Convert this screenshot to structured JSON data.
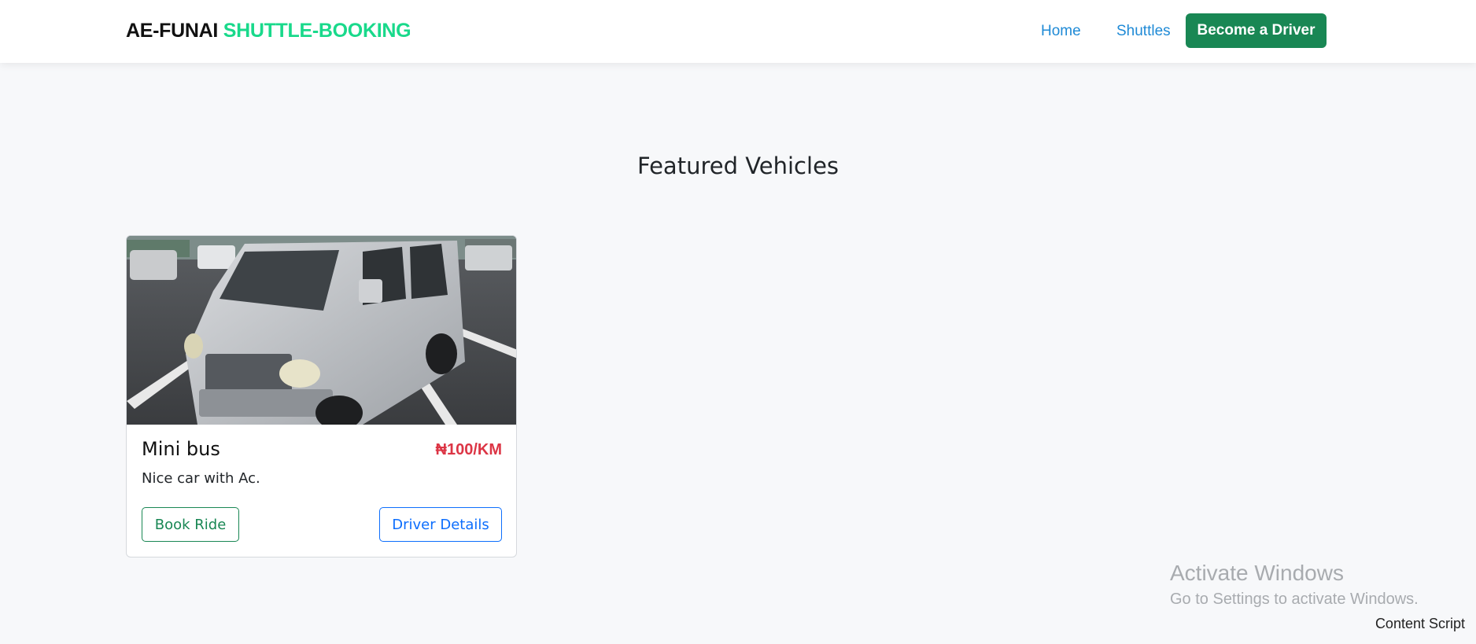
{
  "navbar": {
    "brand_part1": "AE-FUNAI",
    "brand_part2": "SHUTTLE-BOOKING",
    "links": [
      {
        "label": "Home"
      },
      {
        "label": "Shuttles"
      }
    ],
    "cta_label": "Become a Driver"
  },
  "main": {
    "section_title": "Featured Vehicles",
    "vehicles": [
      {
        "title": "Mini bus",
        "price": "₦100/KM",
        "description": "Nice car with Ac.",
        "book_label": "Book Ride",
        "details_label": "Driver Details"
      }
    ]
  },
  "overlay": {
    "activate_title": "Activate Windows",
    "activate_sub": "Go to Settings to activate Windows.",
    "content_script": "Content Script"
  },
  "colors": {
    "brand_accent": "#19d98b",
    "primary_green": "#198754",
    "link_blue": "#1f8ad6",
    "price_red": "#dc3545",
    "outline_blue": "#0d6efd"
  },
  "icons": [
    "vehicle-photo"
  ]
}
